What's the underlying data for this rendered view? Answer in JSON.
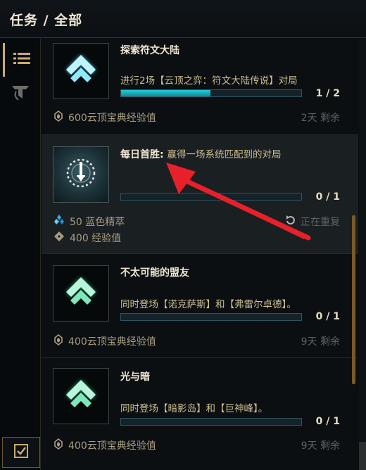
{
  "header": {
    "title": "任务 / 全部"
  },
  "sidebar": {
    "items": [
      {
        "icon": "list-icon"
      },
      {
        "icon": "tft-logo-icon"
      }
    ],
    "bottom": {
      "icon": "checkbox-icon"
    }
  },
  "quests": [
    {
      "title": "探索符文大陆",
      "description": "进行2场【云顶之弈：符文大陆传说】对局",
      "progress": "1 / 2",
      "progress_fraction": 0.5,
      "reward": "600云顶宝典经验值",
      "remaining": "2天 剩余"
    },
    {
      "title": "每日首胜:",
      "description": "赢得一场系统匹配到的对局",
      "progress": "0 / 1",
      "progress_fraction": 0,
      "rewards": [
        "50 蓝色精萃",
        "400 经验值"
      ],
      "status": "正在重复"
    },
    {
      "title": "不太可能的盟友",
      "description": "同时登场【诺克萨斯】和【弗雷尔卓德】。",
      "progress": "0 / 1",
      "progress_fraction": 0,
      "reward": "400云顶宝典经验值",
      "remaining": "9天 剩余"
    },
    {
      "title": "光与暗",
      "description": "同时登场【暗影岛】和【巨神峰】。",
      "progress": "0 / 1",
      "progress_fraction": 0,
      "reward": "400云顶宝典经验值",
      "remaining": "9天 剩余"
    }
  ],
  "colors": {
    "gold": "#c8aa6e",
    "progress": "#1fb3c2",
    "arrow": "#e8202a"
  }
}
